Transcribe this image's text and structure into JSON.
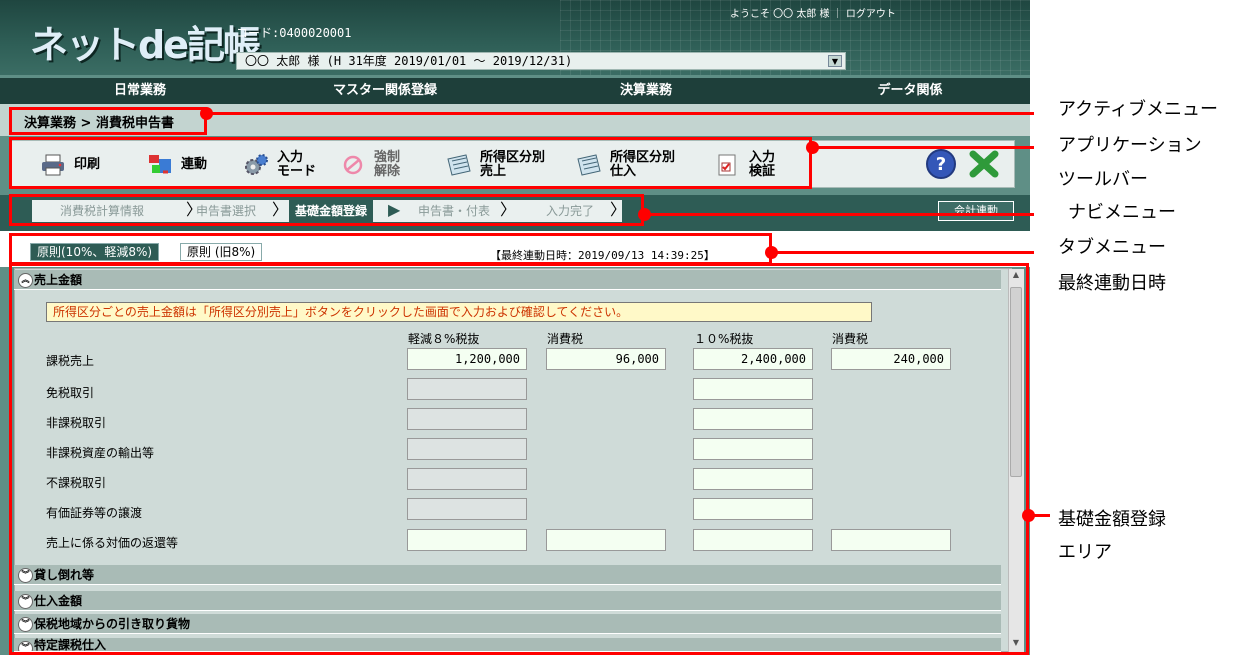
{
  "header": {
    "logo_main": "ネットde記帳",
    "code_label": "コード:0400020001",
    "user_info": "〇〇 太郎 様 (H 31年度 2019/01/01 ～ 2019/12/31)",
    "welcome": "ようこそ 〇〇 太郎 様 ｜ ログアウト"
  },
  "main_menu": [
    "日常業務",
    "マスター関係登録",
    "決算業務",
    "データ関係"
  ],
  "breadcrumb": "決算業務 > 消費税申告書",
  "toolbar": {
    "print": "印刷",
    "link": "連動",
    "input_mode_1": "入力",
    "input_mode_2": "モード",
    "force_1": "強制",
    "force_2": "解除",
    "sales_1": "所得区分別",
    "sales_2": "売上",
    "purchase_1": "所得区分別",
    "purchase_2": "仕入",
    "check_1": "入力",
    "check_2": "検証"
  },
  "navi": {
    "steps": [
      "消費税計算情報",
      "申告書選択",
      "基礎金額登録",
      "申告書・付表",
      "入力完了"
    ],
    "active_index": 2,
    "kaikei_button": "会計連動"
  },
  "tabs": [
    "原則(10%、軽減8%)",
    "原則 (旧8%)"
  ],
  "last_sync": "【最終連動日時：2019/09/13 14:39:25】",
  "sections": {
    "sales": "売上金額",
    "bad_debt": "貸し倒れ等",
    "purchase": "仕入金額",
    "bonded": "保税地域からの引き取り貨物",
    "specific": "特定課税仕入"
  },
  "notice": "所得区分ごとの売上金額は「所得区分別売上」ボタンをクリックした画面で入力および確認してください。",
  "columns": [
    "軽減８%税抜",
    "消費税",
    "１０%税抜",
    "消費税"
  ],
  "rows": [
    {
      "label": "課税売上",
      "values": [
        "1,200,000",
        "96,000",
        "2,400,000",
        "240,000"
      ]
    },
    {
      "label": "免税取引",
      "values": [
        "",
        "",
        "",
        ""
      ]
    },
    {
      "label": "非課税取引",
      "values": [
        "",
        "",
        "",
        ""
      ]
    },
    {
      "label": "非課税資産の輸出等",
      "values": [
        "",
        "",
        "",
        ""
      ]
    },
    {
      "label": "不課税取引",
      "values": [
        "",
        "",
        "",
        ""
      ]
    },
    {
      "label": "有価証券等の譲渡",
      "values": [
        "",
        "",
        "",
        ""
      ]
    },
    {
      "label": "売上に係る対価の返還等",
      "values": [
        "",
        "",
        "",
        ""
      ]
    }
  ],
  "annotations": {
    "active_menu": "アクティブメニュー",
    "app_toolbar_1": "アプリケーション",
    "app_toolbar_2": "ツールバー",
    "navi_menu": "ナビメニュー",
    "tab_menu_1": "タブメニュー",
    "tab_menu_2": "最終連動日時",
    "basic_area_1": "基礎金額登録",
    "basic_area_2": "エリア"
  },
  "colors": {
    "header_dark": "#1f4640",
    "accent_teal": "#2e5c55",
    "annotation_red": "#ff0000",
    "notice_text": "#cc3300"
  }
}
